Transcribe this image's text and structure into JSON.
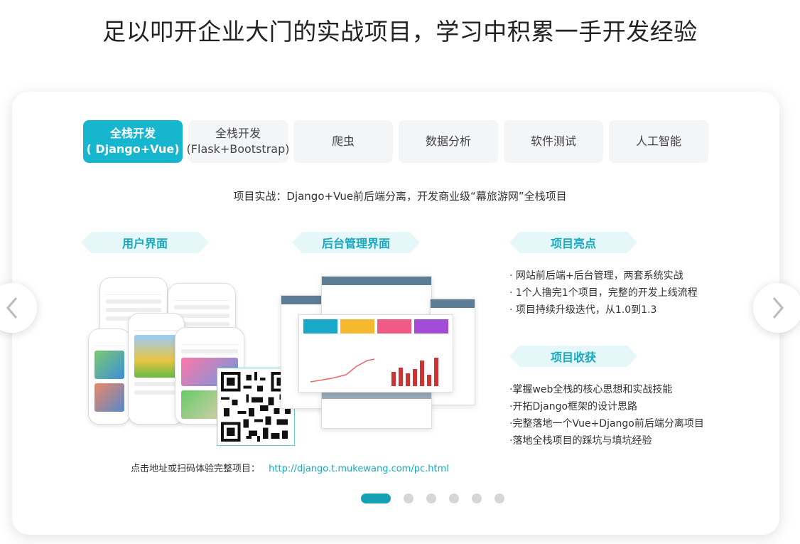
{
  "headline": "足以叩开企业大门的实战项目，学习中积累一手开发经验",
  "tabs": [
    {
      "line1": "全栈开发",
      "line2": "( Django+Vue)",
      "active": true
    },
    {
      "line1": "全栈开发",
      "line2": "(Flask+Bootstrap)",
      "active": false
    },
    {
      "line1": "爬虫",
      "line2": "",
      "active": false
    },
    {
      "line1": "数据分析",
      "line2": "",
      "active": false
    },
    {
      "line1": "软件测试",
      "line2": "",
      "active": false
    },
    {
      "line1": "人工智能",
      "line2": "",
      "active": false
    }
  ],
  "subtitle": "项目实战：Django+Vue前后端分离，开发商业级“幕旅游网”全栈项目",
  "sections": {
    "user_ui": "用户界面",
    "admin_ui": "后台管理界面",
    "highlights_title": "项目亮点",
    "gains_title": "项目收获"
  },
  "highlights": [
    "· 网站前后端+后台管理，两套系统实战",
    "· 1个人撸完1个项目，完整的开发上线流程",
    "· 项目持续升级迭代，从1.0到1.3"
  ],
  "gains": [
    "·掌握web全栈的核心思想和实战技能",
    "·开拓Django框架的设计思路",
    "·完整落地一个Vue+Django前后端分离项目",
    "·落地全栈项目的踩坑与填坑经验"
  ],
  "link": {
    "label": "点击地址或扫码体验完整项目：",
    "url": "http://django.t.mukewang.com/pc.html"
  },
  "carousel": {
    "count": 6,
    "active_index": 0
  },
  "colors": {
    "accent": "#17b6cf",
    "ribbon_bg": "#e6f7fa",
    "dot_active": "#17a0b5"
  },
  "icons": {
    "prev": "chevron-left-icon",
    "next": "chevron-right-icon"
  }
}
